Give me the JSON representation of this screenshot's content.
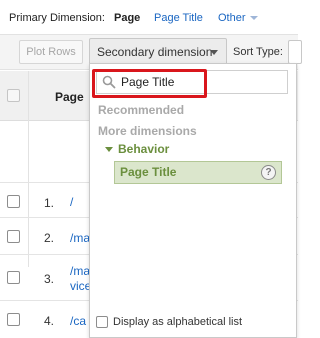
{
  "primary_dimension": {
    "label": "Primary Dimension:",
    "active": "Page",
    "options": [
      "Page Title"
    ],
    "other": "Other"
  },
  "toolbar": {
    "plot_rows": "Plot Rows",
    "secondary_dimension": "Secondary dimension",
    "sort_type_label": "Sort Type:"
  },
  "table": {
    "column_header": "Page",
    "rows": [
      {
        "num": "1.",
        "text": "/"
      },
      {
        "num": "2.",
        "text": "/ma"
      },
      {
        "num": "3.",
        "text": "/ma\nvice"
      },
      {
        "num": "4.",
        "text": "/ca"
      }
    ]
  },
  "dropdown": {
    "search_value": "Page Title",
    "recommended": "Recommended",
    "more_dimensions": "More dimensions",
    "category": "Behavior",
    "item": "Page Title",
    "help": "?",
    "alphabetical_label": "Display as alphabetical list"
  },
  "colors": {
    "link": "#1a66c2",
    "highlight": "#d9161c",
    "green": "#6b8f3e",
    "green_bg": "#dbe6cc"
  }
}
